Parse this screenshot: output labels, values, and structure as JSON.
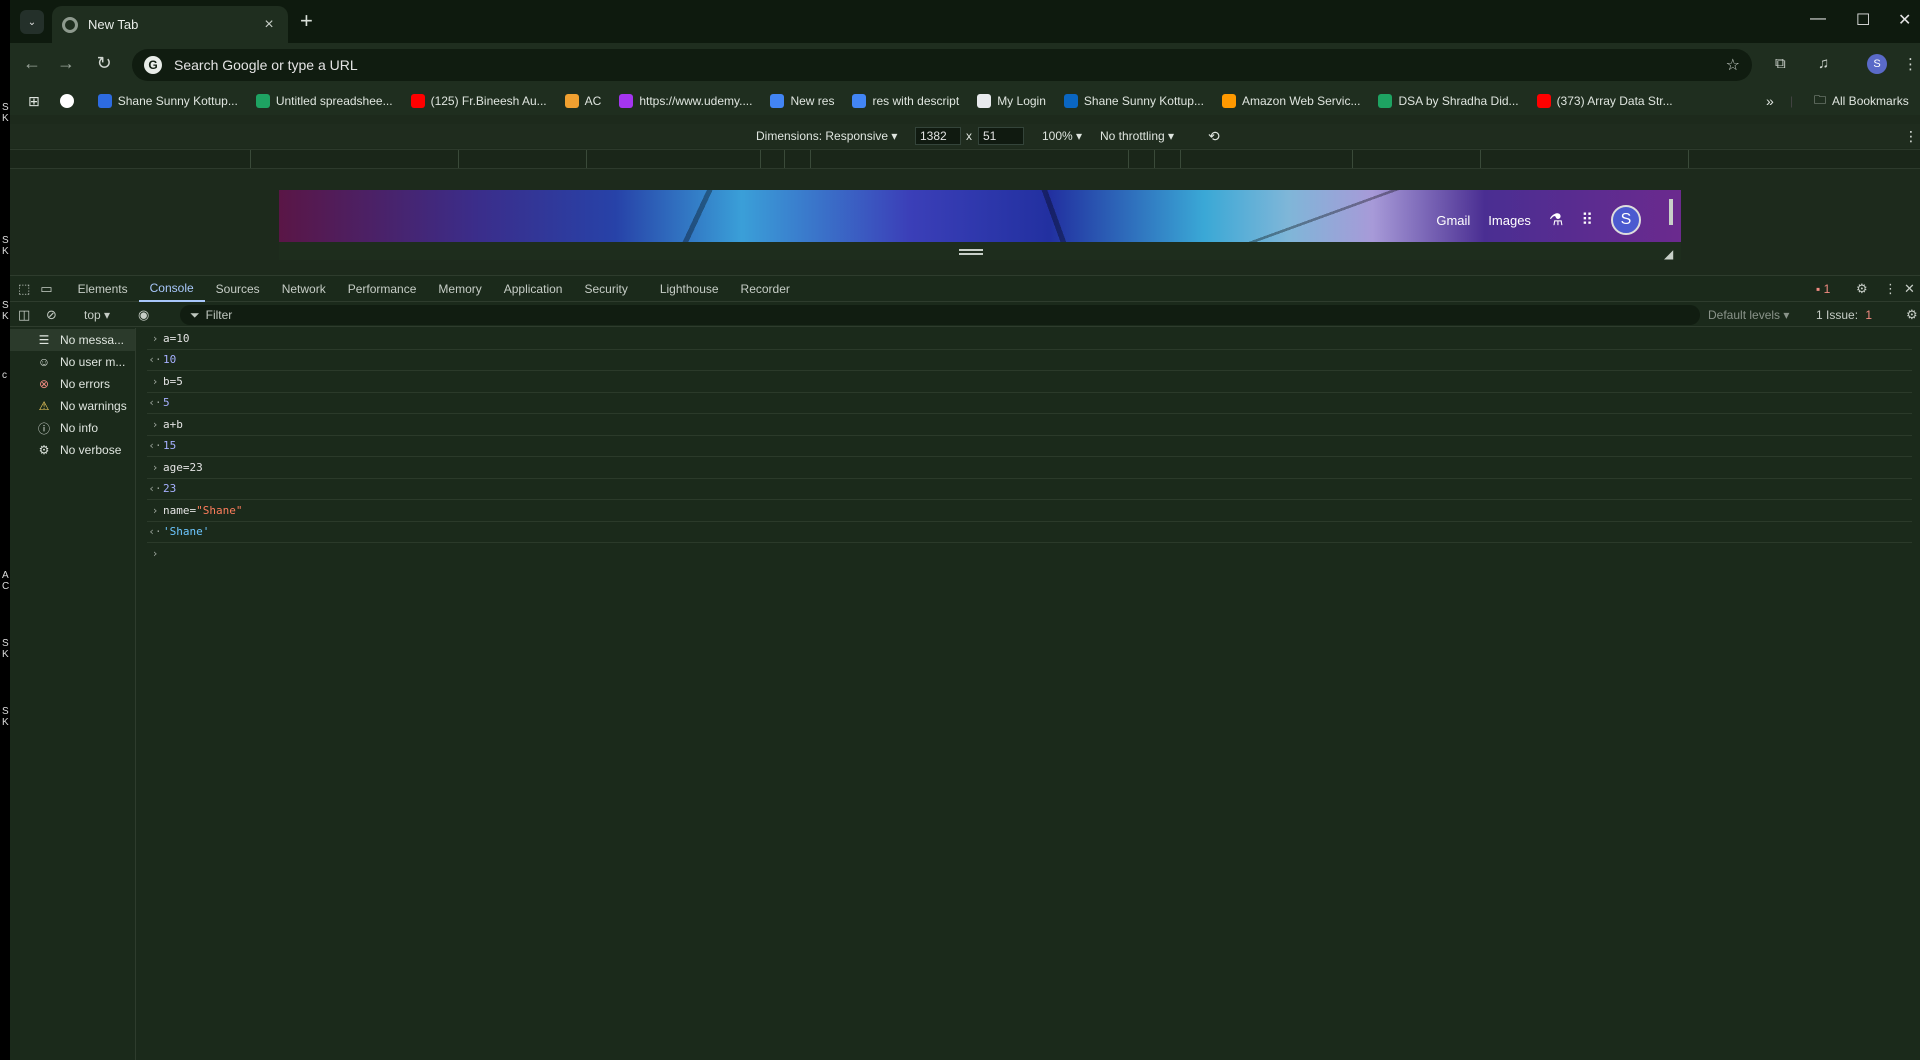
{
  "window": {
    "tab_title": "New Tab",
    "new_tab_symbol": "+",
    "minimize": "—",
    "maximize": "☐",
    "close": "✕"
  },
  "toolbar": {
    "omnibox_placeholder": "Search Google or type a URL",
    "profile_initial": "S"
  },
  "bookmarks": [
    {
      "label": "",
      "color": "#ffffff"
    },
    {
      "label": "Shane Sunny Kottup...",
      "color": "#2d6be0"
    },
    {
      "label": "Untitled spreadshee...",
      "color": "#1ea362"
    },
    {
      "label": "(125) Fr.Bineesh Au...",
      "color": "#ff0000"
    },
    {
      "label": "AC",
      "color": "#f0a030"
    },
    {
      "label": "https://www.udemy....",
      "color": "#a435f0"
    },
    {
      "label": "New res",
      "color": "#4285f4"
    },
    {
      "label": "res with descript",
      "color": "#4285f4"
    },
    {
      "label": "My Login",
      "color": "#e8eaed"
    },
    {
      "label": "Shane Sunny Kottup...",
      "color": "#0a66c2"
    },
    {
      "label": "Amazon Web Servic...",
      "color": "#ff9900"
    },
    {
      "label": "DSA by Shradha Did...",
      "color": "#1ea362"
    },
    {
      "label": "(373) Array Data Str...",
      "color": "#ff0000"
    }
  ],
  "bookmarks_overflow": "»",
  "all_bookmarks": "All Bookmarks",
  "device_toolbar": {
    "dimensions_label": "Dimensions: Responsive ▾",
    "width": "1382",
    "times": "x",
    "height": "51",
    "zoom": "100% ▾",
    "throttling": "No throttling ▾"
  },
  "page": {
    "gmail": "Gmail",
    "images": "Images",
    "avatar": "S"
  },
  "devtools": {
    "tabs": [
      "Elements",
      "Console",
      "Sources",
      "Network",
      "Performance",
      "Memory",
      "Application",
      "Security",
      "Lighthouse",
      "Recorder"
    ],
    "active_tab": "Console",
    "error_count": "1",
    "context": "top ▾",
    "filter_placeholder": "Filter",
    "levels": "Default levels ▾",
    "issues_label": "1 Issue:",
    "issues_count": "1"
  },
  "sidebar": [
    {
      "icon": "☰",
      "label": "No messa...",
      "color": "#dfe5df"
    },
    {
      "icon": "☺",
      "label": "No user m...",
      "color": "#dfe5df"
    },
    {
      "icon": "⊗",
      "label": "No errors",
      "color": "#f28b82"
    },
    {
      "icon": "⚠",
      "label": "No warnings",
      "color": "#fdd663"
    },
    {
      "icon": "ⓘ",
      "label": "No info",
      "color": "#dfe5df"
    },
    {
      "icon": "⚙",
      "label": "No verbose",
      "color": "#dfe5df"
    }
  ],
  "console": [
    {
      "kind": "input",
      "text": "a=10"
    },
    {
      "kind": "result-num",
      "text": "10"
    },
    {
      "kind": "input",
      "text": "b=5"
    },
    {
      "kind": "result-num",
      "text": "5"
    },
    {
      "kind": "input",
      "text": "a+b"
    },
    {
      "kind": "result-num",
      "text": "15"
    },
    {
      "kind": "input",
      "text": "age=23"
    },
    {
      "kind": "result-num",
      "text": "23"
    },
    {
      "kind": "input-str",
      "prefix": "name=",
      "text": "\"Shane\""
    },
    {
      "kind": "result-str",
      "text": "'Shane'"
    }
  ],
  "edge_letters": [
    "S",
    "K",
    "S",
    "K",
    "S",
    "K",
    "c",
    "A",
    "C",
    "S",
    "K",
    "S",
    "K"
  ]
}
